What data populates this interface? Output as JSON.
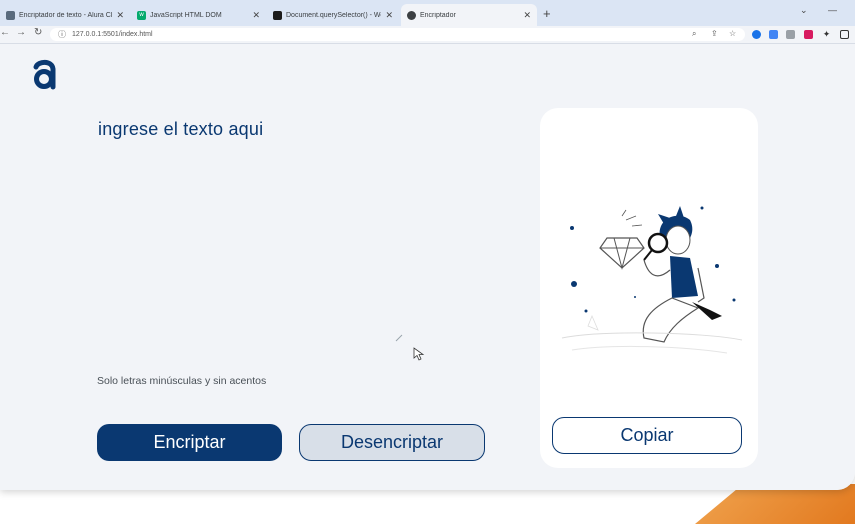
{
  "browser": {
    "tabs": [
      {
        "title": "Encriptador de texto - Alura Cha",
        "active": false
      },
      {
        "title": "JavaScript HTML DOM",
        "active": false
      },
      {
        "title": "Document.querySelector() - Web",
        "active": false
      },
      {
        "title": "Encriptador",
        "active": true
      }
    ],
    "new_tab": "+",
    "url": "127.0.0.1:5501/index.html"
  },
  "app": {
    "logo_letter": "a",
    "input_placeholder": "ingrese el texto aqui",
    "hint": "Solo letras minúsculas y sin acentos",
    "encrypt_label": "Encriptar",
    "decrypt_label": "Desencriptar",
    "copy_label": "Copiar"
  },
  "colors": {
    "primary": "#0a3871",
    "background": "#f2f4f8",
    "accent": "#e2791f"
  },
  "icons": [
    "back-arrow-icon",
    "forward-arrow-icon",
    "reload-icon",
    "info-icon",
    "zoom-icon",
    "share-icon",
    "star-icon",
    "extensions-icon",
    "sidebar-icon"
  ]
}
